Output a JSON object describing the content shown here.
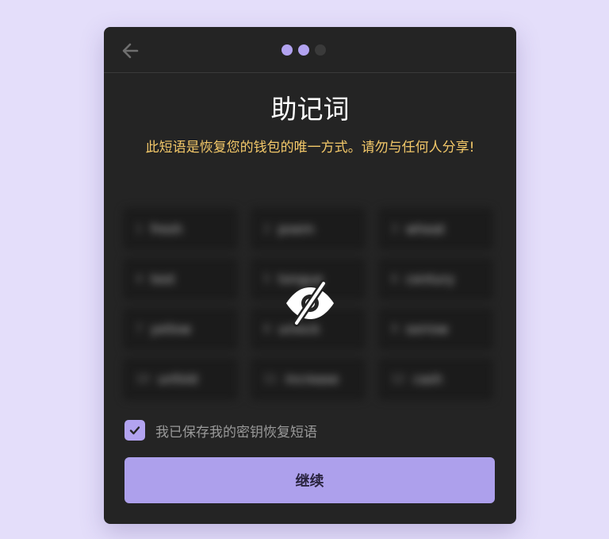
{
  "header": {
    "back_icon": "arrow-left-icon",
    "steps": [
      {
        "state": "complete",
        "color": "#b2a3f0"
      },
      {
        "state": "current",
        "color": "#b2a3f0"
      },
      {
        "state": "upcoming",
        "color": "#3a3a3a"
      }
    ],
    "current_step": 2,
    "total_steps": 3
  },
  "main": {
    "title": "助记词",
    "warning": "此短语是恢复您的钱包的唯一方式。请勿与任何人分享!",
    "warning_color": "#f3c869",
    "phrase_hidden": true,
    "reveal_icon": "eye-slash-icon",
    "words": [
      {
        "index": "1",
        "word": "fresh"
      },
      {
        "index": "2",
        "word": "poem"
      },
      {
        "index": "3",
        "word": "wheat"
      },
      {
        "index": "4",
        "word": "test"
      },
      {
        "index": "5",
        "word": "tongue"
      },
      {
        "index": "6",
        "word": "century"
      },
      {
        "index": "7",
        "word": "yellow"
      },
      {
        "index": "8",
        "word": "unlock"
      },
      {
        "index": "9",
        "word": "sorrow"
      },
      {
        "index": "10",
        "word": "unfold"
      },
      {
        "index": "11",
        "word": "increase"
      },
      {
        "index": "12",
        "word": "cash"
      }
    ]
  },
  "confirm": {
    "label": "我已保存我的密钥恢复短语",
    "checked": true,
    "check_icon": "checkmark-icon"
  },
  "footer": {
    "continue_label": "继续",
    "accent": "#ada0ec"
  }
}
